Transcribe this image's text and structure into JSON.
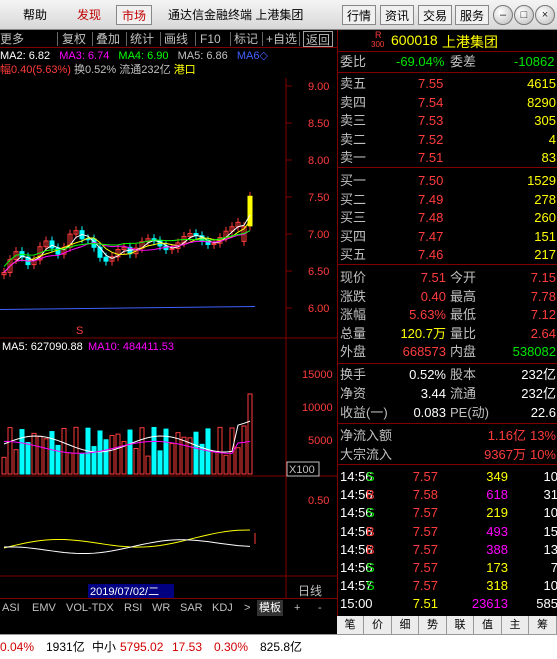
{
  "menu": {
    "help": "帮助",
    "discover": "发现",
    "market": "市场",
    "app_title": "通达信金融终端 上港集团",
    "quotes": "行情",
    "info": "资讯",
    "trade": "交易",
    "service": "服务"
  },
  "toolbar": {
    "more": "更多",
    "fuquan": "复权",
    "overlay": "叠加",
    "stats": "统计",
    "draw": "画线",
    "f10": "F10",
    "mark": "标记",
    "add_fav": "+自选",
    "back": "返回"
  },
  "ma_line": {
    "ma2": "MA2: 6.82",
    "ma3": "MA3: 6.74",
    "ma4": "MA4: 6.90",
    "ma5": "MA5: 6.86",
    "ma6": "MA6"
  },
  "info_line": {
    "change": "幅0.40(5.63%)",
    "turnover": "换0.52%",
    "float": "流通232亿",
    "hk": "港口"
  },
  "price_axis": [
    "9.00",
    "8.50",
    "8.00",
    "7.50",
    "7.00",
    "6.50",
    "6.00"
  ],
  "vol_header": {
    "ma5": "MA5: 627090.88",
    "ma10": "MA10: 484411.53"
  },
  "vol_axis": [
    "15000",
    "10000",
    "5000"
  ],
  "vol_unit": "X100",
  "ind_axis": [
    "0.50"
  ],
  "date_label": "2019/07/02/二",
  "period": "日线",
  "s_marker": "S",
  "tabs": [
    "ASI",
    "EMV",
    "VOL-TDX",
    "RSI",
    "WR",
    "SAR",
    "KDJ",
    ">",
    "模板",
    "+",
    "-"
  ],
  "stock": {
    "code": "600018",
    "name": "上港集团",
    "r_label": "R",
    "r_num": "300"
  },
  "weibi": {
    "label1": "委比",
    "val1": "-69.04%",
    "label2": "委差",
    "val2": "-10862"
  },
  "sell": [
    {
      "label": "卖五",
      "price": "7.55",
      "vol": "4615"
    },
    {
      "label": "卖四",
      "price": "7.54",
      "vol": "8290"
    },
    {
      "label": "卖三",
      "price": "7.53",
      "vol": "305"
    },
    {
      "label": "卖二",
      "price": "7.52",
      "vol": "4"
    },
    {
      "label": "卖一",
      "price": "7.51",
      "vol": "83"
    }
  ],
  "buy": [
    {
      "label": "买一",
      "price": "7.50",
      "vol": "1529"
    },
    {
      "label": "买二",
      "price": "7.49",
      "vol": "278"
    },
    {
      "label": "买三",
      "price": "7.48",
      "vol": "260"
    },
    {
      "label": "买四",
      "price": "7.47",
      "vol": "151"
    },
    {
      "label": "买五",
      "price": "7.46",
      "vol": "217"
    }
  ],
  "quote": [
    {
      "l1": "现价",
      "v1": "7.51",
      "l2": "今开",
      "v2": "7.15"
    },
    {
      "l1": "涨跌",
      "v1": "0.40",
      "l2": "最高",
      "v2": "7.78"
    },
    {
      "l1": "涨幅",
      "v1": "5.63%",
      "l2": "最低",
      "v2": "7.12"
    },
    {
      "l1": "总量",
      "v1": "120.7万",
      "l2": "量比",
      "v2": "2.64"
    },
    {
      "l1": "外盘",
      "v1": "668573",
      "l2": "内盘",
      "v2": "538082"
    }
  ],
  "fund": [
    {
      "l1": "换手",
      "v1": "0.52%",
      "l2": "股本",
      "v2": "232亿"
    },
    {
      "l1": "净资",
      "v1": "3.44",
      "l2": "流通",
      "v2": "232亿"
    },
    {
      "l1": "收益(一)",
      "v1": "0.083",
      "l2": "PE(动)",
      "v2": "22.6"
    }
  ],
  "flow": [
    {
      "label": "净流入额",
      "val": "1.16亿",
      "pct": "13%"
    },
    {
      "label": "大宗流入",
      "val": "9367万",
      "pct": "10%"
    }
  ],
  "ticks": [
    {
      "time": "14:56",
      "price": "7.57",
      "vol": "349",
      "side": "S",
      "n": "10"
    },
    {
      "time": "14:56",
      "price": "7.58",
      "vol": "618",
      "side": "B",
      "n": "31"
    },
    {
      "time": "14:56",
      "price": "7.57",
      "vol": "219",
      "side": "S",
      "n": "10"
    },
    {
      "time": "14:56",
      "price": "7.57",
      "vol": "493",
      "side": "B",
      "n": "15"
    },
    {
      "time": "14:56",
      "price": "7.57",
      "vol": "388",
      "side": "B",
      "n": "13"
    },
    {
      "time": "14:56",
      "price": "7.57",
      "vol": "173",
      "side": "S",
      "n": "7"
    },
    {
      "time": "14:57",
      "price": "7.57",
      "vol": "318",
      "side": "S",
      "n": "10"
    },
    {
      "time": "15:00",
      "price": "7.51",
      "vol": "23613",
      "side": "",
      "n": "585"
    }
  ],
  "rtabs": [
    "笔",
    "价",
    "细",
    "势",
    "联",
    "值",
    "主",
    "筹"
  ],
  "statusbar": {
    "pct": "0.04%",
    "amt": "1931亿",
    "idx_name": "中小",
    "idx_val": "5795.02",
    "idx_chg": "17.53",
    "idx_pct": "0.30%",
    "idx_amt": "825.8亿"
  },
  "colors": {
    "up": "#ff3c3c",
    "down": "#00ffff",
    "frame": "#800000"
  }
}
